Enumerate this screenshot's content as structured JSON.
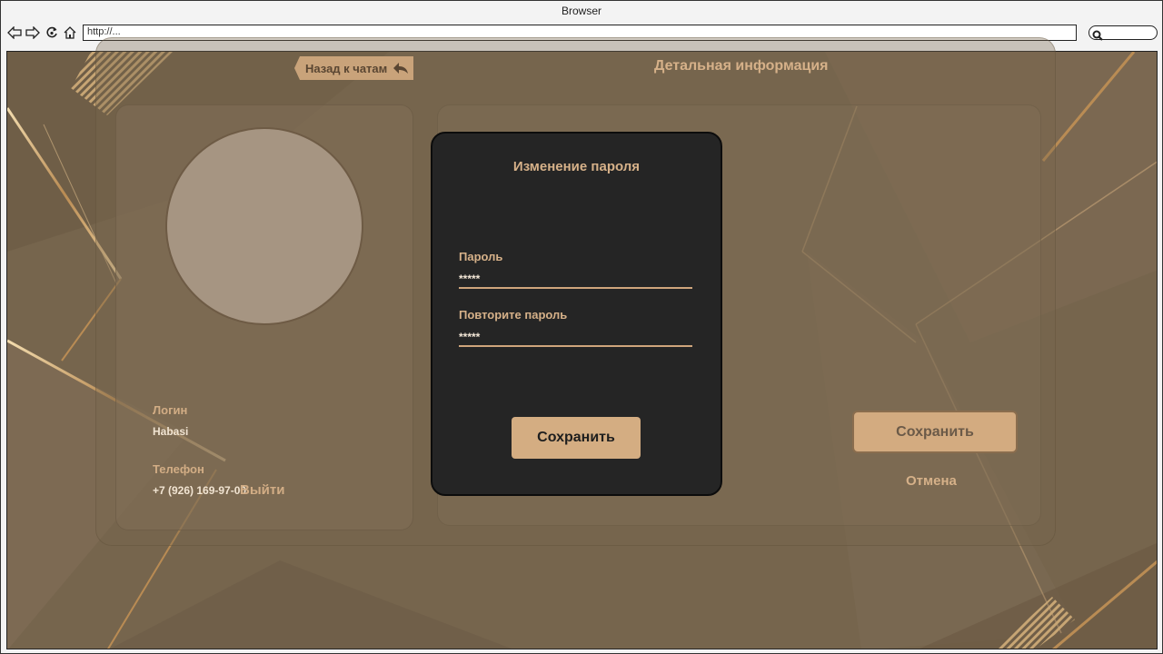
{
  "browser": {
    "title": "Browser",
    "address": "http://..."
  },
  "icons": {
    "back": "arrow-left-icon",
    "forward": "arrow-right-icon",
    "reload": "reload-icon",
    "home": "home-icon",
    "search": "search-icon",
    "reply": "reply-arrow-icon"
  },
  "colors": {
    "background": "#76654d",
    "accent": "#d4ad82",
    "modal": "#252525"
  },
  "header": {
    "back_label": "Назад к чатам",
    "title": "Детальная информация"
  },
  "profile": {
    "login_label": "Логин",
    "login_value": "Habasi",
    "phone_label": "Телефон",
    "phone_value": "+7 (926) 169-97-00",
    "logout_label": "Выйти"
  },
  "details": {
    "save_label": "Сохранить",
    "cancel_label": "Отмена"
  },
  "modal": {
    "title": "Изменение пароля",
    "password_label": "Пароль",
    "password_value": "*****",
    "repeat_label": "Повторите пароль",
    "repeat_value": "*****",
    "save_label": "Сохранить"
  }
}
